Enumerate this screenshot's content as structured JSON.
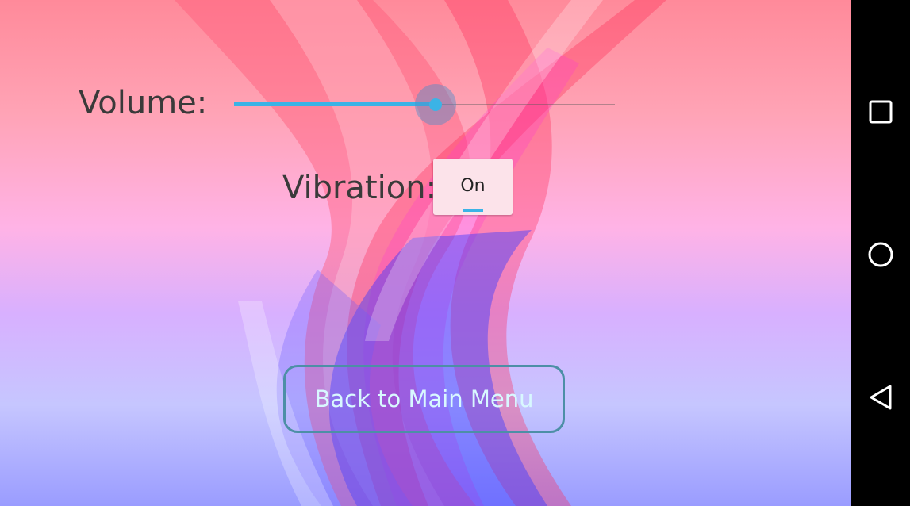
{
  "settings": {
    "volume_label": "Volume:",
    "volume_level": 0.53,
    "vibration_label": "Vibration:",
    "vibration_state": "On",
    "back_button_label": "Back to Main Menu"
  },
  "colors": {
    "accent": "#3bb3e6",
    "button_border": "#4d8fa6",
    "button_text": "#d8f8ff",
    "label_text": "#3a3a3a",
    "nav_bar": "#000000"
  },
  "nav_bar": {
    "icons": [
      "overview-square-icon",
      "home-circle-icon",
      "back-triangle-icon"
    ]
  }
}
